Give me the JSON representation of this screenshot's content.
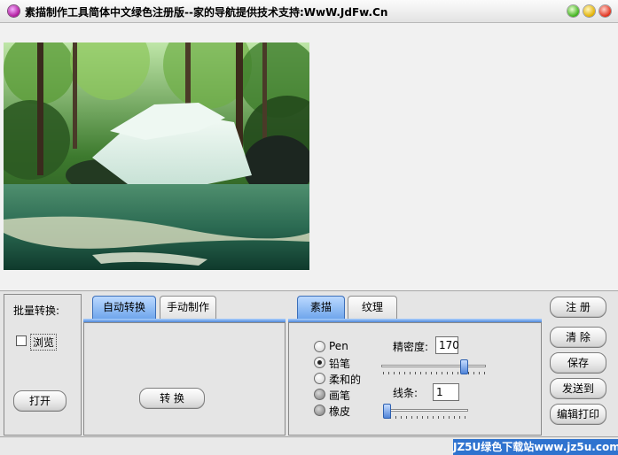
{
  "window": {
    "title": "素描制作工具简体中文绿色注册版--家的导航提供技术支持:WwW.JdFw.Cn"
  },
  "colors": {
    "tab_active": "#6fa6ec",
    "watermark_bg": "#2f73cf",
    "title_icon": "#b0189c"
  },
  "batch": {
    "title": "批量转换:",
    "browse_label": "浏览",
    "browse_checked": false,
    "open_label": "打开"
  },
  "convert_tabs": {
    "auto_label": "自动转换",
    "manual_label": "手动制作",
    "convert_button": "转  换"
  },
  "sketch_tabs": {
    "sketch_label": "素描",
    "texture_label": "纹理"
  },
  "tools": {
    "pen": "Pen",
    "pencil": "铅笔",
    "soft": "柔和的",
    "brush": "画笔",
    "eraser": "橡皮",
    "selected": "铅笔"
  },
  "density": {
    "label": "精密度:",
    "value": "170",
    "slider_fraction": 0.82
  },
  "lines": {
    "label": "线条:",
    "value": "1",
    "slider_fraction": 0.0
  },
  "actions": {
    "register": "注 册",
    "clear": "清 除",
    "save": "保存",
    "send_to": "发送到",
    "edit_print": "编辑打印"
  },
  "statusbar": {
    "watermark": "JZ5U绿色下载站www.jz5u.com"
  },
  "image": {
    "icon": "waterfall-photo"
  }
}
